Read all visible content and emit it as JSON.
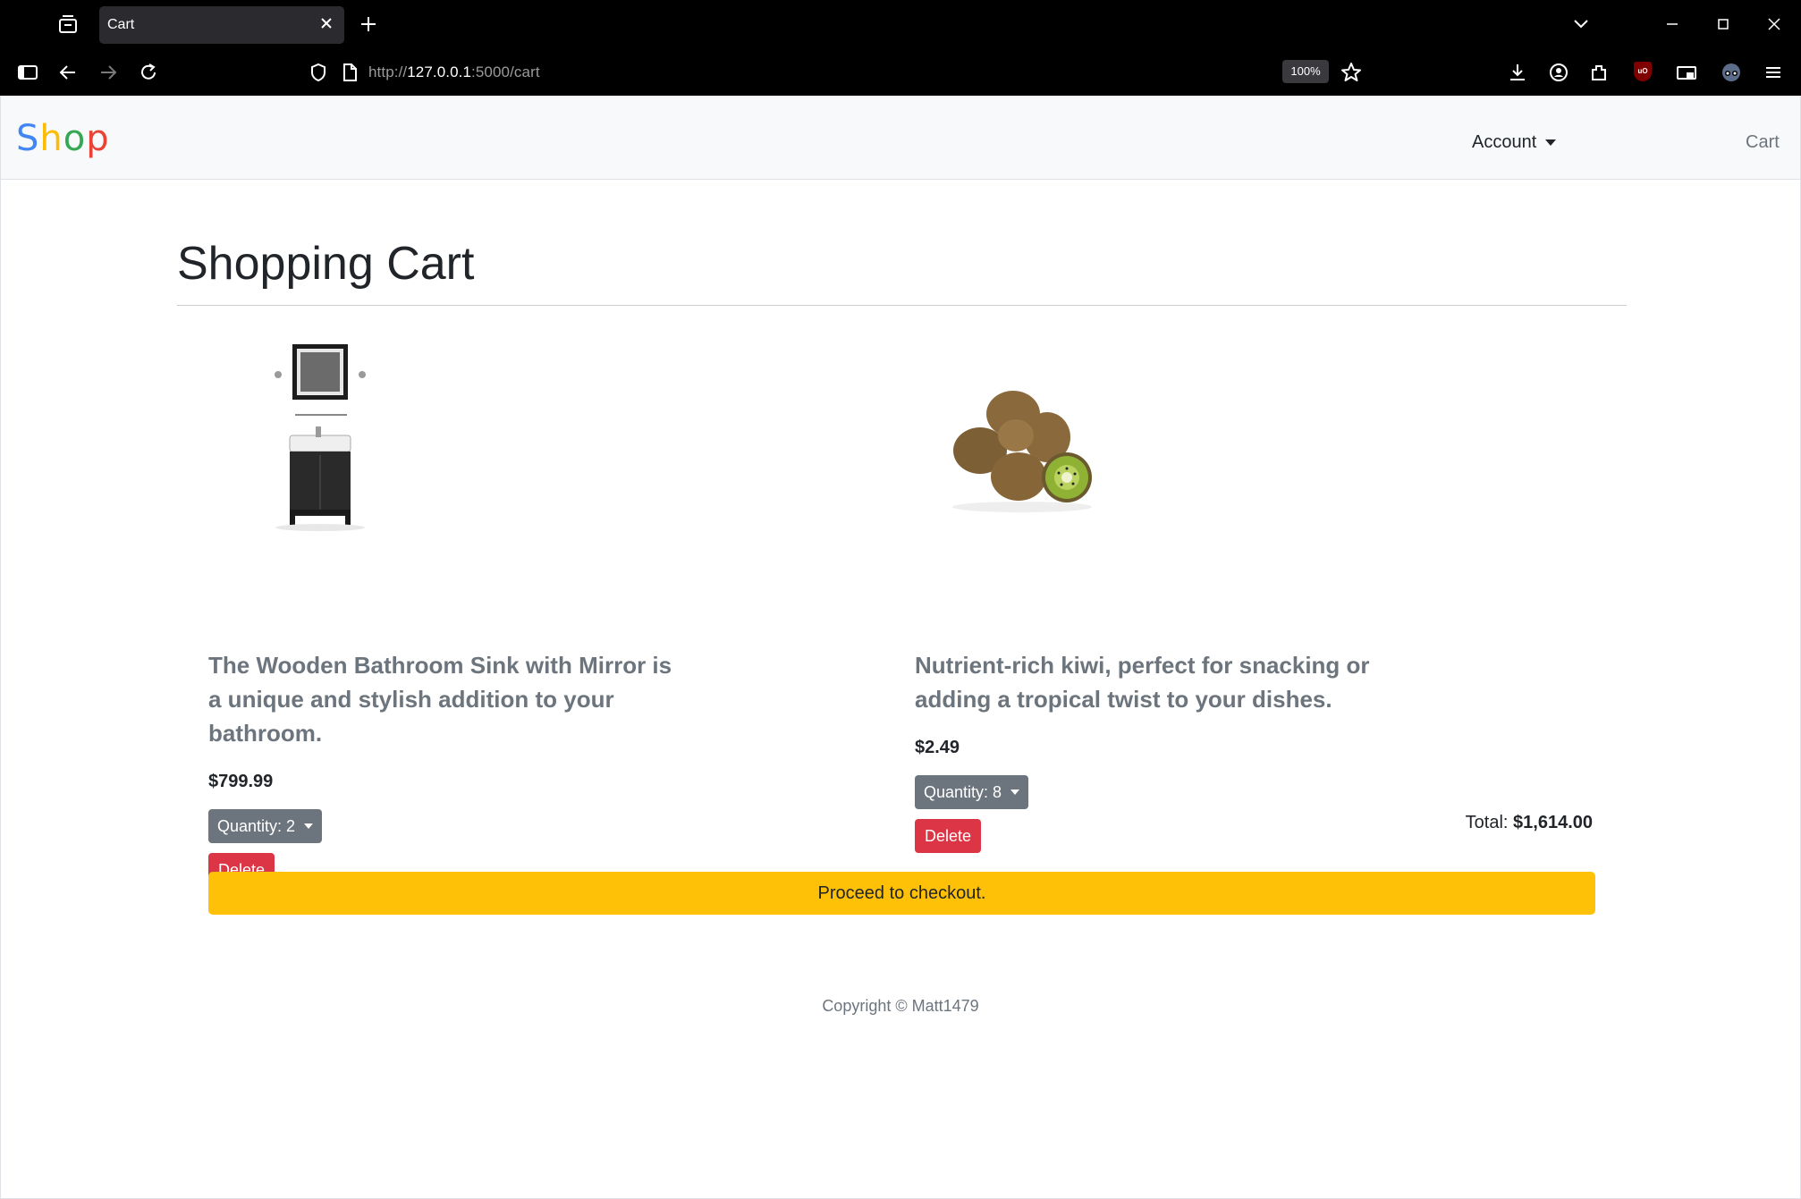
{
  "browser": {
    "tab_title": "Cart",
    "url_prefix": "http://",
    "url_host": "127.0.0.1",
    "url_path": ":5000/cart",
    "zoom": "100%"
  },
  "nav": {
    "brand_letters": [
      "S",
      "h",
      "o",
      "p"
    ],
    "account_label": "Account",
    "cart_label": "Cart"
  },
  "page": {
    "title": "Shopping Cart"
  },
  "products": [
    {
      "description": "The Wooden Bathroom Sink with Mirror is a unique and stylish addition to your bathroom.",
      "price": "$799.99",
      "quantity_label": "Quantity: 2",
      "delete_label": "Delete"
    },
    {
      "description": "Nutrient-rich kiwi, perfect for snacking or adding a tropical twist to your dishes.",
      "price": "$2.49",
      "quantity_label": "Quantity: 8",
      "delete_label": "Delete"
    }
  ],
  "cart": {
    "total_label": "Total:",
    "total_value": "$1,614.00",
    "checkout_label": "Proceed to checkout."
  },
  "footer": {
    "copyright": "Copyright © Matt1479"
  },
  "colors": {
    "checkout": "#ffc107",
    "delete": "#dc3545",
    "quantity": "#6c757d",
    "brand_s": "#4285f4",
    "brand_h": "#fbbc05",
    "brand_o": "#34a853",
    "brand_p": "#ea4335"
  }
}
